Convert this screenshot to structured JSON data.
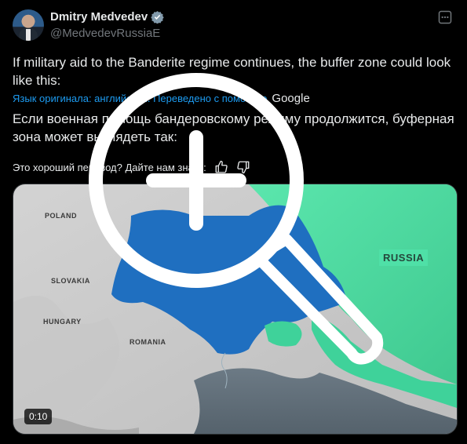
{
  "tweet": {
    "display_name": "Dmitry Medvedev",
    "handle": "@MedvedevRussiaE",
    "text": "If military aid to the Banderite regime continues, the buffer zone could look like this:",
    "translation_note": "Язык оригинала: английский. Переведено с помощью",
    "translation_provider": "Google",
    "translated_text": "Если военная помощь бандеровскому режиму продолжится, буферная зона может выглядеть так:",
    "feedback_prompt": "Это хороший перевод? Дайте нам знать:"
  },
  "media": {
    "labels": {
      "poland": "POLAND",
      "slovakia": "SLOVAKIA",
      "hungary": "HUNGARY",
      "romania": "ROMANIA",
      "russia": "RUSSIA"
    },
    "timestamp": "0:10"
  },
  "colors": {
    "background": "#000000",
    "text": "#e7e9ea",
    "muted": "#71767b",
    "link": "#1d9bf0",
    "ukraine_blue": "#1f6fc0",
    "russia_green": "#56e3a8"
  },
  "icons": {
    "verified": "verified-badge-icon",
    "more": "more-options-icon",
    "thumbs_up": "thumbs-up-icon",
    "thumbs_down": "thumbs-down-icon",
    "zoom": "zoom-in-magnifier-icon"
  }
}
